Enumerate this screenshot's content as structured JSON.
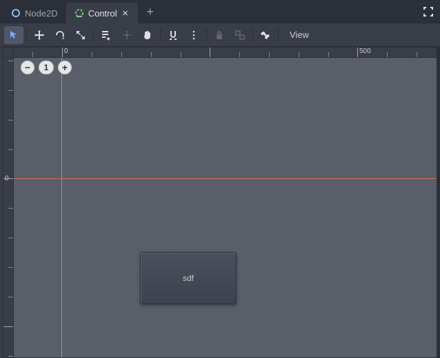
{
  "tabs": [
    {
      "label": "Node2D",
      "active": false,
      "icon_color": "#8eb8ff"
    },
    {
      "label": "Control",
      "active": true,
      "icon_color": "#7ac97a"
    }
  ],
  "toolbar": {
    "view_label": "View"
  },
  "zoom": {
    "level": "1"
  },
  "ruler": {
    "h_labels": [
      {
        "pos": 70,
        "text": "0"
      },
      {
        "pos": 498,
        "text": "500"
      }
    ],
    "h_ticks": [
      27,
      70,
      113,
      156,
      199,
      242,
      284,
      327,
      370,
      413,
      456,
      498,
      541,
      584
    ],
    "h_majors": [
      70,
      284,
      498
    ],
    "v_labels": [
      {
        "pos": 170,
        "text": "0"
      }
    ],
    "v_ticks": [
      4,
      47,
      90,
      133,
      175,
      218,
      261,
      304,
      347,
      390,
      433
    ],
    "v_majors": [
      175,
      390
    ]
  },
  "canvas": {
    "node_label": "sdf"
  }
}
